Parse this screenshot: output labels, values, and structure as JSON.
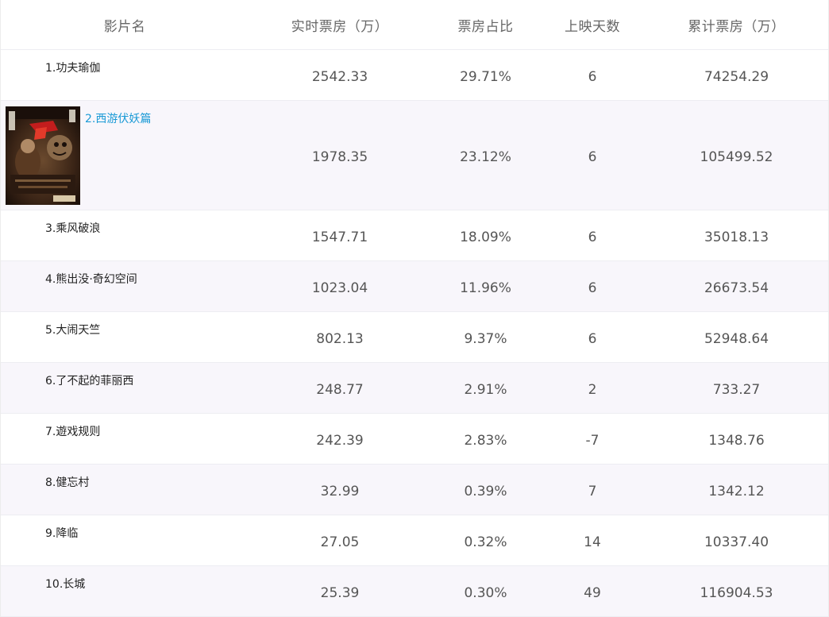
{
  "header": {
    "col_title": "影片名",
    "col_realtime": "实时票房（万）",
    "col_share": "票房占比",
    "col_days": "上映天数",
    "col_total": "累计票房（万）"
  },
  "movies": [
    {
      "title": "1.功夫瑜伽",
      "realtime": "2542.33",
      "share": "29.71%",
      "days": "6",
      "total": "74254.29"
    },
    {
      "title": "2.西游伏妖篇",
      "realtime": "1978.35",
      "share": "23.12%",
      "days": "6",
      "total": "105499.52"
    },
    {
      "title": "3.乘风破浪",
      "realtime": "1547.71",
      "share": "18.09%",
      "days": "6",
      "total": "35018.13"
    },
    {
      "title": "4.熊出没·奇幻空间",
      "realtime": "1023.04",
      "share": "11.96%",
      "days": "6",
      "total": "26673.54"
    },
    {
      "title": "5.大闹天竺",
      "realtime": "802.13",
      "share": "9.37%",
      "days": "6",
      "total": "52948.64"
    },
    {
      "title": "6.了不起的菲丽西",
      "realtime": "248.77",
      "share": "2.91%",
      "days": "2",
      "total": "733.27"
    },
    {
      "title": "7.遊戏规则",
      "realtime": "242.39",
      "share": "2.83%",
      "days": "-7",
      "total": "1348.76"
    },
    {
      "title": "8.健忘村",
      "realtime": "32.99",
      "share": "0.39%",
      "days": "7",
      "total": "1342.12"
    },
    {
      "title": "9.降临",
      "realtime": "27.05",
      "share": "0.32%",
      "days": "14",
      "total": "10337.40"
    },
    {
      "title": "10.长城",
      "realtime": "25.39",
      "share": "0.30%",
      "days": "49",
      "total": "116904.53"
    }
  ],
  "colors": {
    "link": "#1a9ad6",
    "alt_row": "#f8f6fb",
    "border": "#ededf2"
  }
}
